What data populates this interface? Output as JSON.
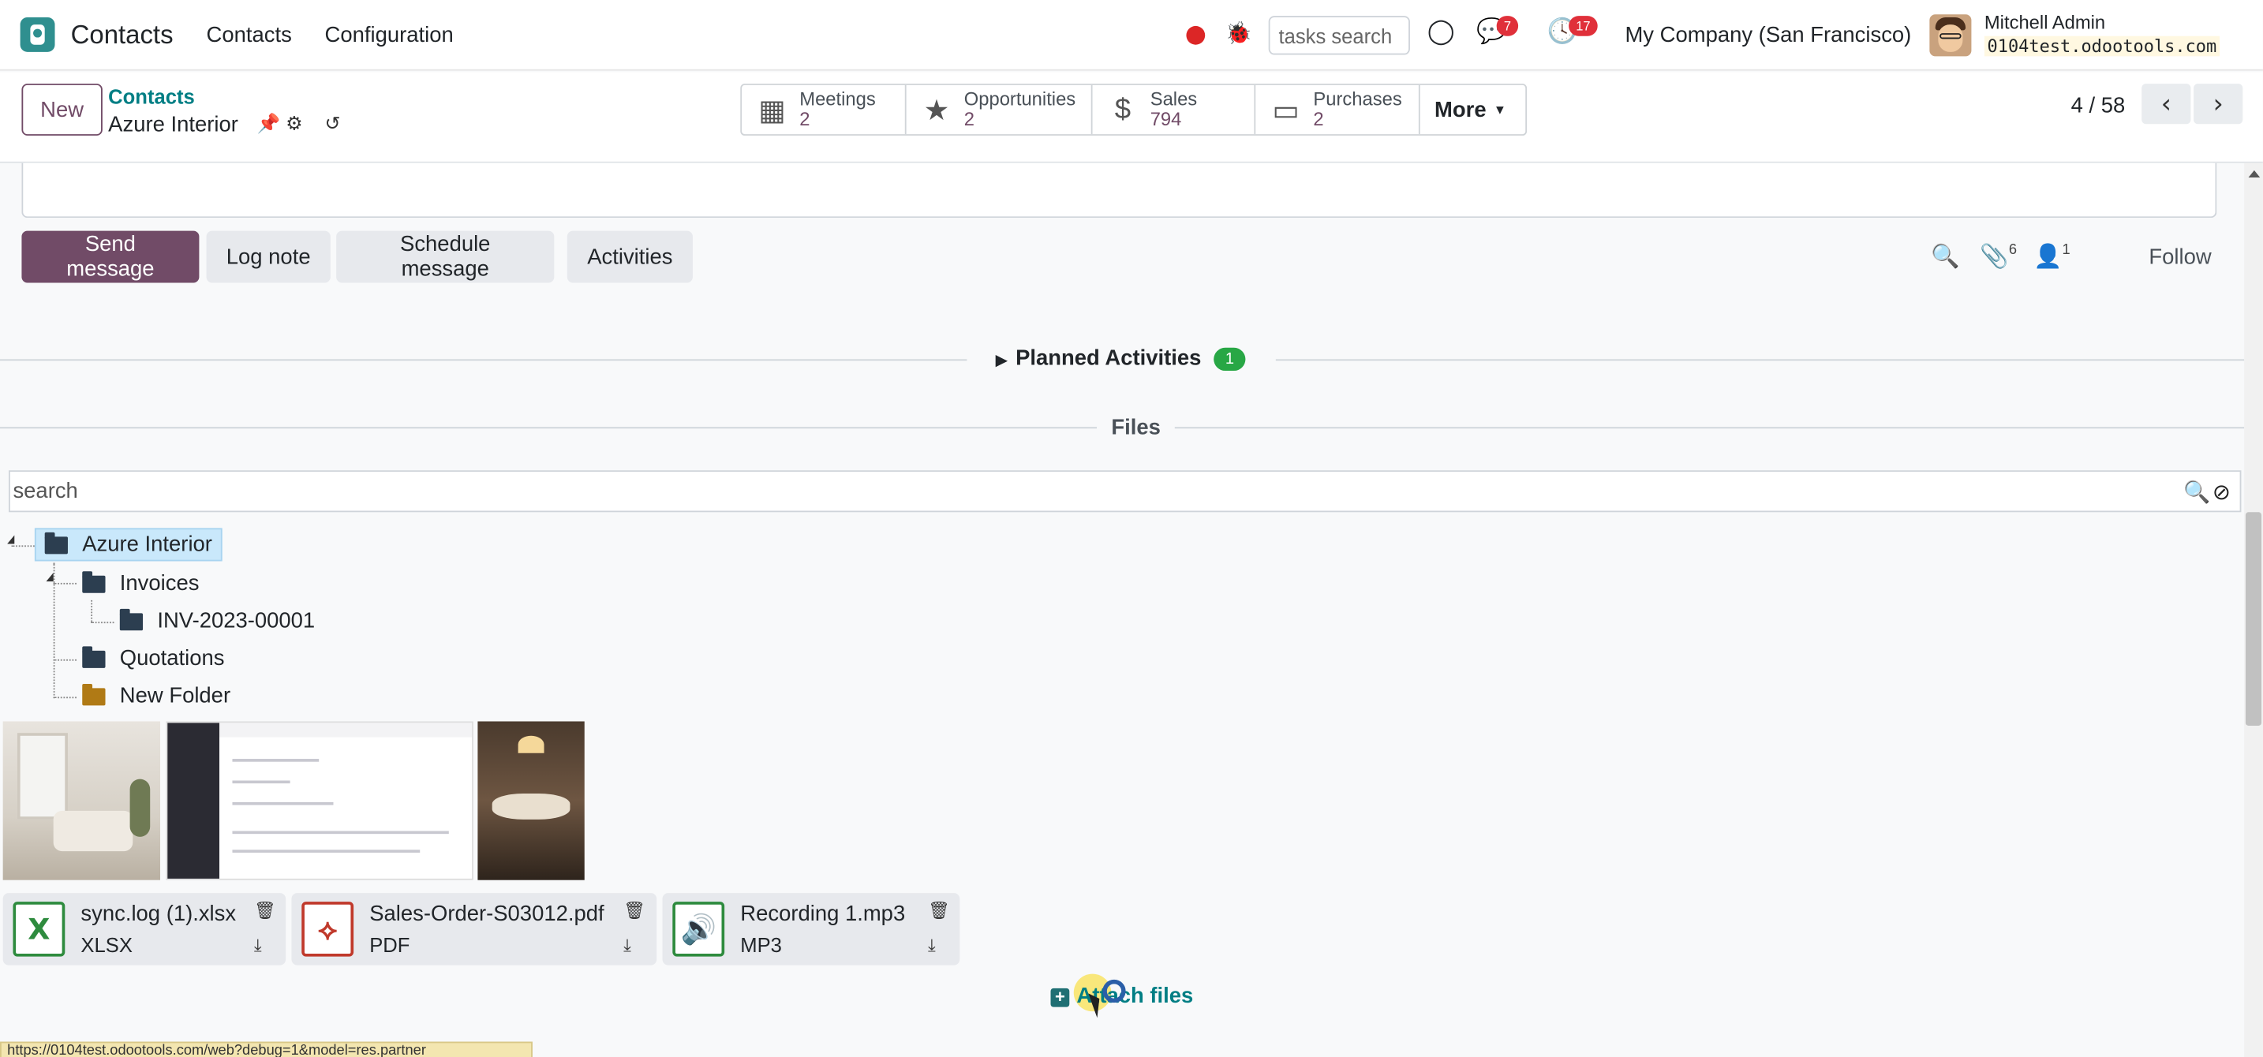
{
  "navbar": {
    "app_name": "Contacts",
    "menu": [
      "Contacts",
      "Configuration"
    ],
    "tasks_search_placeholder": "tasks search",
    "messages_count": "7",
    "activities_count": "17",
    "company": "My Company (San Francisco)",
    "user_name": "Mitchell Admin",
    "database": "0104test.odootools.com"
  },
  "control_panel": {
    "new_label": "New",
    "breadcrumb": "Contacts",
    "record_name": "Azure Interior",
    "smart_buttons": [
      {
        "label": "Meetings",
        "value": "2",
        "icon": "calendar-icon"
      },
      {
        "label": "Opportunities",
        "value": "2",
        "icon": "star-icon"
      },
      {
        "label": "Sales",
        "value": "794",
        "icon": "dollar-icon"
      },
      {
        "label": "Purchases",
        "value": "2",
        "icon": "credit-card-icon"
      }
    ],
    "more_label": "More",
    "pager": "4 / 58"
  },
  "chatter": {
    "send_message": "Send message",
    "log_note": "Log note",
    "schedule_message": "Schedule message",
    "activities": "Activities",
    "attachments_count": "6",
    "followers_count": "1",
    "follow_label": "Follow",
    "planned_activities": "Planned Activities",
    "planned_count": "1"
  },
  "files": {
    "title": "Files",
    "search_placeholder": "search",
    "tree": [
      {
        "label": "Azure Interior",
        "level": 0
      },
      {
        "label": "Invoices",
        "level": 1
      },
      {
        "label": "INV-2023-00001",
        "level": 2
      },
      {
        "label": "Quotations",
        "level": 1
      },
      {
        "label": "New Folder",
        "level": 1
      }
    ],
    "attachments": [
      {
        "name": "sync.log (1).xlsx",
        "type": "XLSX",
        "icon": "excel-icon",
        "color": "#2e8b3e"
      },
      {
        "name": "Sales-Order-S03012.pdf",
        "type": "PDF",
        "icon": "pdf-icon",
        "color": "#c0392b"
      },
      {
        "name": "Recording 1.mp3",
        "type": "MP3",
        "icon": "audio-icon",
        "color": "#2e8b3e"
      }
    ],
    "attach_label": "Attach files"
  },
  "status_url": "https://0104test.odootools.com/web?debug=1&model=res.partner"
}
